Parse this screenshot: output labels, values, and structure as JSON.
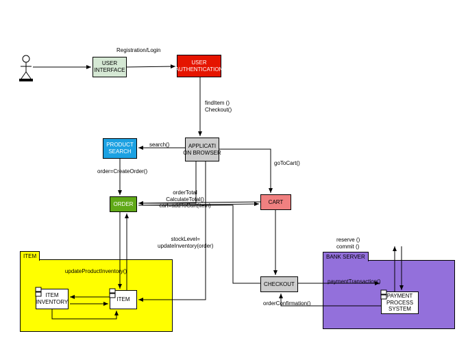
{
  "actor": "",
  "nodes": {
    "ui": "USER INTERFACE",
    "auth": "USER AUTHENTICATION",
    "appBrowser": "APPLICATI\nON BROWSER",
    "productSearch": "PRODUCT SEARCH",
    "order": "ORDER",
    "cart": "CART",
    "checkout": "CHECKOUT",
    "item": "ITEM",
    "itemInventory": "ITEM INVENTORY",
    "paymentProcess": "PAYMENT PROCESS SYSTEM"
  },
  "folders": {
    "item": "ITEM",
    "bank": "BANK SERVER"
  },
  "edges": {
    "regLogin": "Registration/Login",
    "findCheckout": "findItem ()\nCheckout()",
    "search": "search()",
    "createOrder": "order=CreateOrder()",
    "orderTotal": "orderTotal CalculateTotal()\ncart=addToCart(item)",
    "goToCart": "goToCart()",
    "stockLevel": "stockLevel=\nupdateInventory(order)",
    "updateProdInv": "updateProductInventory()",
    "reserveCommit": "reserve ()\ncommit ()",
    "paymentTxn": "paymentTransaction()",
    "orderConfirm": "orderConfirmation()"
  }
}
